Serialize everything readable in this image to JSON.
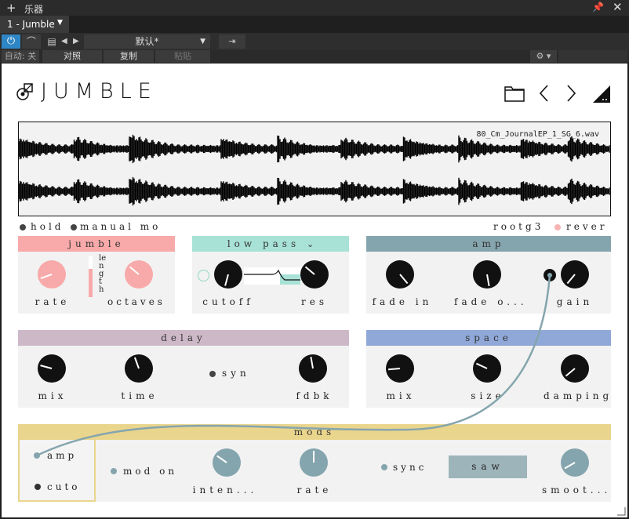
{
  "host": {
    "window_title": "乐器",
    "tab_label": "1 - Jumble",
    "preset_name": "默认*",
    "auto_label": "自动: 关",
    "compare_label": "对照",
    "copy_label": "复制",
    "paste_label": "粘贴"
  },
  "plugin": {
    "brand": "JUMBLE",
    "filename": "80_Cm_JournalEP_1_SG_6.wav",
    "toggles": {
      "hold": "hold",
      "manual": "manual mo",
      "root": "rootg3",
      "reverse": "rever"
    },
    "jumble": {
      "title": "jumble",
      "rate": "rate",
      "length": "length",
      "octaves": "octaves"
    },
    "lowpass": {
      "title": "low pass",
      "cutoff": "cutoff",
      "res": "res"
    },
    "amp": {
      "title": "amp",
      "fade_in": "fade in",
      "fade_out": "fade o...",
      "gain": "gain"
    },
    "delay": {
      "title": "delay",
      "mix": "mix",
      "time": "time",
      "syn": "syn",
      "fdbk": "fdbk"
    },
    "space": {
      "title": "space",
      "mix": "mix",
      "size": "size",
      "damping": "damping"
    },
    "mods": {
      "title": "mods",
      "amp": "amp",
      "cuto": "cuto",
      "mod_on": "mod on",
      "inten": "inten...",
      "rate": "rate",
      "sync": "sync",
      "wave": "saw",
      "smooth": "smoot..."
    }
  },
  "colors": {
    "jumble": "#f8a9a9",
    "lowpass": "#a8e2d6",
    "amp": "#85a5ae",
    "delay": "#cdb8c8",
    "space": "#8fa8d8",
    "mods": "#ead58c",
    "accent_blue": "#2f86c6"
  }
}
